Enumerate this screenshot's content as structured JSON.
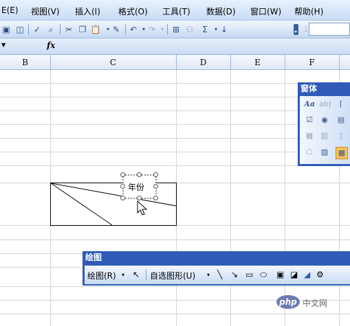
{
  "menubar": {
    "items": [
      "E(E)",
      "视图(V)",
      "插入(I)",
      "格式(O)",
      "工具(T)",
      "数据(D)",
      "窗口(W)",
      "帮助(H)"
    ]
  },
  "formula_bar": {
    "fx_label": "fx",
    "name_box_value": "",
    "formula_value": ""
  },
  "columns": [
    "B",
    "C",
    "D",
    "E",
    "F"
  ],
  "cell": {
    "text_box_content": "年份"
  },
  "forms_toolbar": {
    "title": "窗体"
  },
  "drawing_toolbar": {
    "title": "绘图",
    "draw_menu_label": "绘图(R)",
    "autoshapes_label": "自选图形(U)"
  },
  "watermark": {
    "text": "php 中文网"
  },
  "colors": {
    "title_blue": "#2f5bb7",
    "toolbar_light": "#f3f7fe",
    "toolbar_dark": "#c5d8f3"
  }
}
